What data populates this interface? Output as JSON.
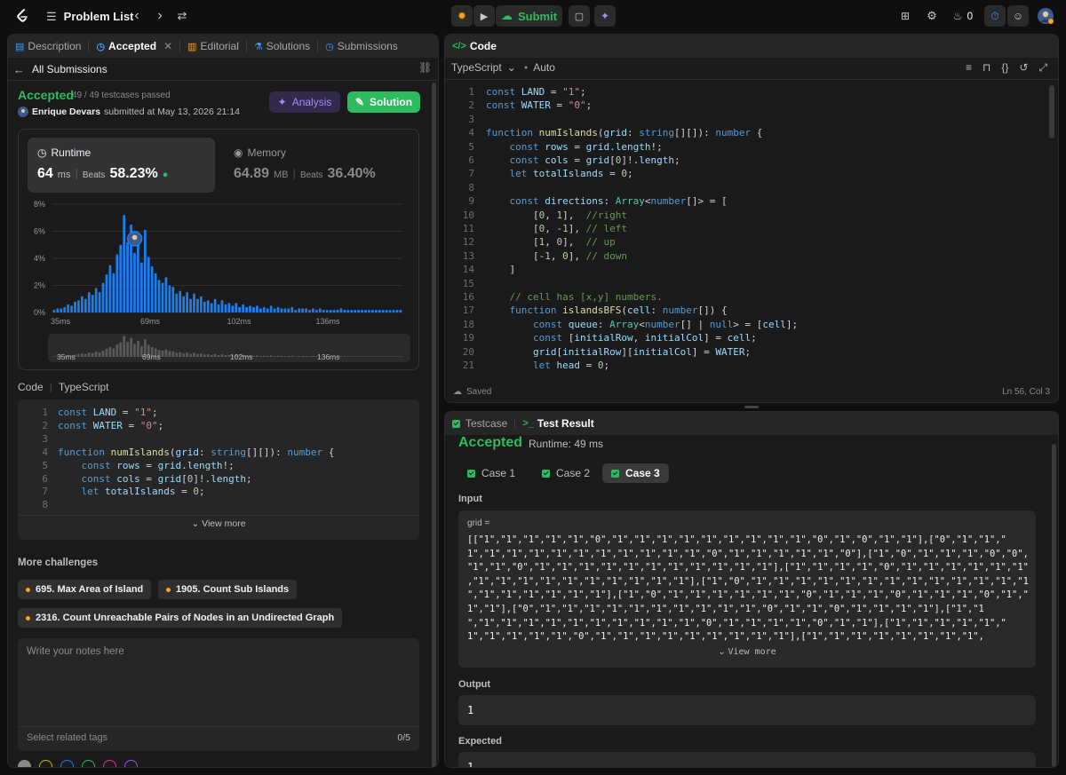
{
  "topbar": {
    "problem_list": "Problem List",
    "submit": "Submit",
    "streak": "0"
  },
  "left_tabs": [
    {
      "label": "Description"
    },
    {
      "label": "Accepted"
    },
    {
      "label": "Editorial"
    },
    {
      "label": "Solutions"
    },
    {
      "label": "Submissions"
    }
  ],
  "submission": {
    "back_label": "All Submissions",
    "status": "Accepted",
    "testcases": "49 / 49 testcases passed",
    "user": "Enrique Devars",
    "submitted": "submitted at May 13, 2026 21:14",
    "analysis_label": "Analysis",
    "solution_label": "Solution",
    "runtime_label": "Runtime",
    "runtime_value": "64",
    "runtime_unit": "ms",
    "runtime_beats_label": "Beats",
    "runtime_beats": "58.23%",
    "memory_label": "Memory",
    "memory_value": "64.89",
    "memory_unit": "MB",
    "memory_beats_label": "Beats",
    "memory_beats": "36.40%"
  },
  "chart_data": {
    "type": "bar",
    "yticks": [
      "8%",
      "6%",
      "4%",
      "2%",
      "0%"
    ],
    "xticks": [
      "35ms",
      "69ms",
      "102ms",
      "136ms"
    ],
    "ylim": [
      0,
      8
    ],
    "values": [
      0.2,
      0.3,
      0.3,
      0.4,
      0.6,
      0.5,
      0.8,
      0.9,
      1.2,
      1.0,
      1.5,
      1.3,
      1.8,
      1.5,
      2.2,
      2.8,
      3.5,
      2.9,
      4.3,
      5.0,
      7.2,
      5.2,
      6.5,
      4.4,
      5.6,
      3.7,
      6.1,
      4.1,
      3.4,
      2.9,
      2.4,
      2.2,
      2.6,
      2.0,
      1.9,
      1.4,
      1.6,
      1.2,
      1.5,
      1.0,
      1.4,
      1.0,
      1.2,
      0.8,
      0.9,
      0.7,
      1.0,
      0.6,
      0.9,
      0.6,
      0.7,
      0.5,
      0.7,
      0.4,
      0.6,
      0.4,
      0.5,
      0.4,
      0.5,
      0.3,
      0.4,
      0.3,
      0.5,
      0.3,
      0.4,
      0.3,
      0.3,
      0.3,
      0.4,
      0.2,
      0.3,
      0.3,
      0.3,
      0.2,
      0.3,
      0.2,
      0.3,
      0.2,
      0.2,
      0.2,
      0.2,
      0.2,
      0.3,
      0.2,
      0.2,
      0.2,
      0.2,
      0.2,
      0.2,
      0.2,
      0.2,
      0.2,
      0.2,
      0.2,
      0.2,
      0.2,
      0.2,
      0.2,
      0.2,
      0.2
    ],
    "highlight_index": 23
  },
  "code_summary": {
    "label": "Code",
    "lang": "TypeScript",
    "view_more": "View more",
    "lines": [
      "const LAND = \"1\";",
      "const WATER = \"0\";",
      "",
      "function numIslands(grid: string[][]): number {",
      "    const rows = grid.length!;",
      "    const cols = grid[0]!.length;",
      "    let totalIslands = 0;",
      ""
    ]
  },
  "challenges": {
    "title": "More challenges",
    "items": [
      "695. Max Area of Island",
      "1905. Count Sub Islands",
      "2316. Count Unreachable Pairs of Nodes in an Undirected Graph"
    ]
  },
  "notes": {
    "placeholder": "Write your notes here",
    "tags_placeholder": "Select related tags",
    "tags_count": "0/5"
  },
  "editor": {
    "title": "Code",
    "language": "TypeScript",
    "mode": "Auto",
    "saved": "Saved",
    "cursor": "Ln 56, Col 3",
    "lines": [
      "const LAND = \"1\";",
      "const WATER = \"0\";",
      "",
      "function numIslands(grid: string[][]): number {",
      "    const rows = grid.length!;",
      "    const cols = grid[0]!.length;",
      "    let totalIslands = 0;",
      "",
      "    const directions: Array<number[]> = [",
      "        [0, 1],  //right",
      "        [0, -1], // left",
      "        [1, 0],  // up",
      "        [-1, 0], // down",
      "    ]",
      "",
      "    // cell has [x,y] numbers.",
      "    function islandsBFS(cell: number[]) {",
      "        const queue: Array<number[] | null> = [cell];",
      "        const [initialRow, initialCol] = cell;",
      "        grid[initialRow][initialCol] = WATER;",
      "        let head = 0;"
    ]
  },
  "result": {
    "tab_testcase": "Testcase",
    "tab_result": "Test Result",
    "status": "Accepted",
    "runtime": "Runtime: 49 ms",
    "cases": [
      "Case 1",
      "Case 2",
      "Case 3"
    ],
    "input_label": "Input",
    "grid_label": "grid =",
    "grid_lines": [
      "[[\"1\",\"1\",\"1\",\"1\",\"1\",\"0\",\"1\",\"1\",\"1\",\"1\",\"1\",\"1\",\"1\",\"1\",\"1\",\"0\",\"1\",\"0\",\"1\",\"1\"],[\"0\",\"1\",\"1\",\"",
      "1\",\"1\",\"1\",\"1\",\"1\",\"1\",\"1\",\"1\",\"1\",\"1\",\"1\",\"0\",\"1\",\"1\",\"1\",\"1\",\"1\",\"0\"],[\"1\",\"0\",\"1\",\"1\",\"1\",\"0\",\"0\",",
      "\"1\",\"1\",\"0\",\"1\",\"1\",\"1\",\"1\",\"1\",\"1\",\"1\",\"1\",\"1\",\"1\",\"1\"],[\"1\",\"1\",\"1\",\"1\",\"0\",\"1\",\"1\",\"1\",\"1\",\"1\",\"1\"",
      ",\"1\",\"1\",\"1\",\"1\",\"1\",\"1\",\"1\",\"1\",\"1\",\"1\"],[\"1\",\"0\",\"1\",\"1\",\"1\",\"1\",\"1\",\"1\",\"1\",\"1\",\"1\",\"1\",\"1\",\"1\",\"1",
      "\",\"1\",\"1\",\"1\",\"1\",\"1\",\"1\"],[\"1\",\"0\",\"1\",\"1\",\"1\",\"1\",\"1\",\"1\",\"0\",\"1\",\"1\",\"1\",\"0\",\"1\",\"1\",\"1\",\"0\",\"1\",\"",
      "1\",\"1\"],[\"0\",\"1\",\"1\",\"1\",\"1\",\"1\",\"1\",\"1\",\"1\",\"1\",\"1\",\"0\",\"1\",\"1\",\"0\",\"1\",\"1\",\"1\",\"1\"],[\"1\",\"1",
      "\",\"1\",\"1\",\"1\",\"1\",\"1\",\"1\",\"1\",\"1\",\"1\",\"1\",\"0\",\"1\",\"1\",\"1\",\"1\",\"0\",\"1\",\"1\"],[\"1\",\"1\",\"1\",\"1\",\"1\",\"",
      "1\",\"1\",\"1\",\"1\",\"1\",\"0\",\"1\",\"1\",\"1\",\"1\",\"1\",\"1\",\"1\",\"1\",\"1\"],[\"1\",\"1\",\"1\",\"1\",\"1\",\"1\",\"1\",\"1\","
    ],
    "view_more": "View more",
    "output_label": "Output",
    "output_value": "1",
    "expected_label": "Expected",
    "expected_value": "1"
  },
  "colors": {
    "accent_green": "#2cbb5d",
    "brand_orange": "#ffa116",
    "bar_blue": "#1a7ef0",
    "analysis_purple": "#a78bfa"
  }
}
